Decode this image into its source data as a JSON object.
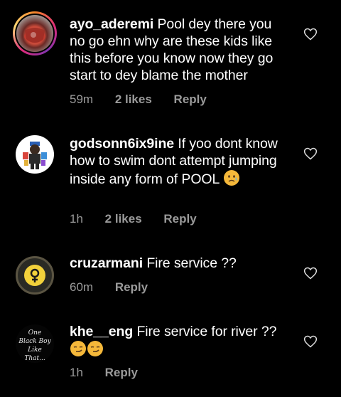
{
  "comments": [
    {
      "username": "ayo_aderemi",
      "text": "Pool dey there you no go ehn why are these kids like this  before you know now they go start to dey blame the mother",
      "time": "59m",
      "likes": "2 likes",
      "reply": "Reply",
      "avatar_icon": "drink-glass-photo"
    },
    {
      "username": "godsonn6ix9ine",
      "text": "If yoo dont know how to swim dont attempt jumping inside any form of POOL",
      "emoji": "disappointed-relieved-emoji",
      "time": "1h",
      "likes": "2 likes",
      "reply": "Reply",
      "avatar_icon": "cartoon-character-illustration"
    },
    {
      "username": "cruzarmani",
      "text": "Fire service ??",
      "time": "60m",
      "reply": "Reply",
      "avatar_icon": "female-symbol-icon"
    },
    {
      "username": "khe__eng",
      "text": "Fire service for river ??",
      "emoji": "smirk-emoji",
      "time": "1h",
      "reply": "Reply",
      "avatar_text": "One Black Boy Like That...",
      "avatar_icon": "text-logo"
    }
  ],
  "colors": {
    "background": "#000000",
    "text": "#ffffff",
    "meta": "#9a9a9a",
    "heart": "#dcdcdc",
    "avatar_yellow": "#f2d13b"
  }
}
